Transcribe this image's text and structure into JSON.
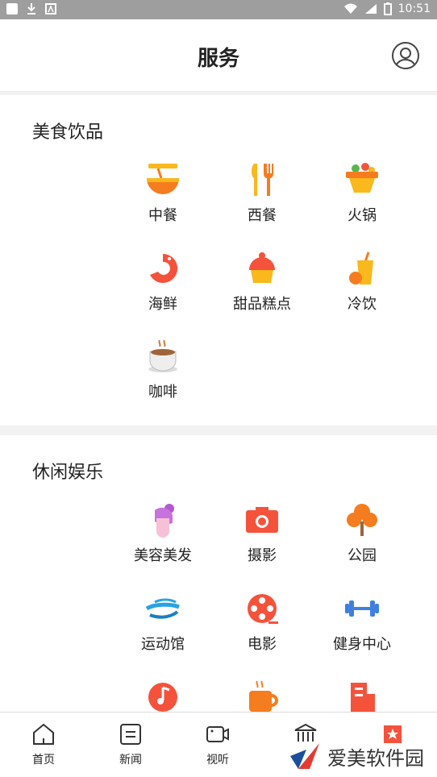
{
  "status_bar": {
    "time": "10:51"
  },
  "header": {
    "title": "服务"
  },
  "sections": [
    {
      "title": "美食饮品",
      "items": [
        {
          "label": "中餐",
          "icon": "noodle-bowl-icon"
        },
        {
          "label": "西餐",
          "icon": "fork-knife-icon"
        },
        {
          "label": "火锅",
          "icon": "hotpot-icon"
        },
        {
          "label": "海鲜",
          "icon": "shrimp-icon"
        },
        {
          "label": "甜品糕点",
          "icon": "cupcake-icon"
        },
        {
          "label": "冷饮",
          "icon": "cold-drink-icon"
        },
        {
          "label": "咖啡",
          "icon": "coffee-cup-icon"
        }
      ]
    },
    {
      "title": "休闲娱乐",
      "items": [
        {
          "label": "美容美发",
          "icon": "hairstyle-icon"
        },
        {
          "label": "摄影",
          "icon": "camera-icon"
        },
        {
          "label": "公园",
          "icon": "tree-icon"
        },
        {
          "label": "运动馆",
          "icon": "stadium-icon"
        },
        {
          "label": "电影",
          "icon": "film-reel-icon"
        },
        {
          "label": "健身中心",
          "icon": "dumbbell-icon"
        },
        {
          "label": "",
          "icon": "music-note-icon"
        },
        {
          "label": "",
          "icon": "tea-cup-icon"
        },
        {
          "label": "",
          "icon": "building-icon"
        }
      ]
    }
  ],
  "tabbar": {
    "items": [
      {
        "label": "首页",
        "icon": "home-icon"
      },
      {
        "label": "新闻",
        "icon": "news-icon"
      },
      {
        "label": "视听",
        "icon": "video-icon"
      },
      {
        "label": "",
        "icon": "service-hall-icon"
      },
      {
        "label": "",
        "icon": "star-badge-icon"
      }
    ]
  },
  "watermark": {
    "text": "爱美软件园"
  },
  "colors": {
    "orange": "#f57c1f",
    "red": "#f5523c",
    "yellow": "#f9b81b",
    "blue": "#3f7fe0",
    "pink": "#e86fb1"
  }
}
